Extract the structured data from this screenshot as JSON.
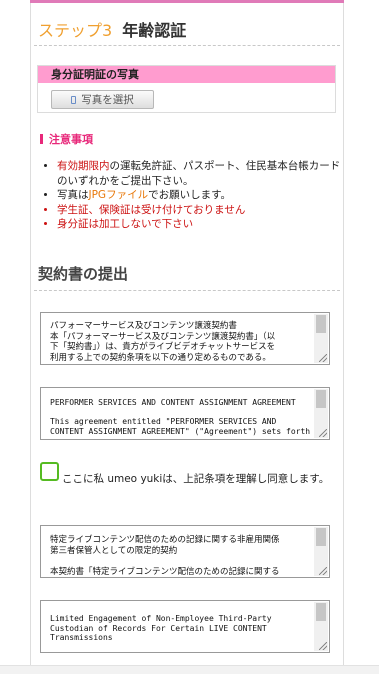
{
  "step": {
    "number_label": "ステップ3",
    "title": "年齢認証"
  },
  "photo": {
    "header": "身分証明証の写真",
    "button_label": "写真を選択"
  },
  "notice": {
    "title": "注意事項",
    "items": [
      {
        "emph": "有効期限内",
        "rest": "の運転免許証、パスポート、住民基本台帳カードのいずれかをご提出下さい。"
      },
      {
        "pre": "写真は",
        "emph": "JPGファイル",
        "post": "でお願いします。"
      },
      {
        "text": "学生証、保険証は受け付けておりません"
      },
      {
        "text": "身分証は加工しないで下さい"
      }
    ]
  },
  "contract": {
    "title": "契約書の提出",
    "box1": "パフォーマーサービス及びコンテンツ譲渡契約書\n本「パフォーマーサービス及びコンテンツ譲渡契約書」（以\n下「契約書」）は、貴方がライブビデオチャットサービスを\n利用する上での契約条項を以下の通り定めるものである。",
    "box2": "PERFORMER SERVICES AND CONTENT ASSIGNMENT AGREEMENT\n\nThis agreement entitled \"PERFORMER SERVICES AND\nCONTENT ASSIGNMENT AGREEMENT\" (\"Agreement\") sets forth",
    "agree_text": "ここに私 umeo yukiは、上記条項を理解し同意します。",
    "box3": "特定ライブコンテンツ配信のための記録に関する非雇用関係\n第三者保管人としての限定的契約\n\n本契約書「特定ライブコンテンツ配信のための記録に関する",
    "box4": "Limited Engagement of Non-Employee Third-Party\nCustodian of Records For Certain LIVE CONTENT\nTransmissions"
  },
  "colors": {
    "accent_pink": "#ff9ccf",
    "notice_pink": "#e8287a",
    "step_orange": "#f0a030",
    "warn_red": "#cc1111",
    "check_green": "#55bb22"
  }
}
